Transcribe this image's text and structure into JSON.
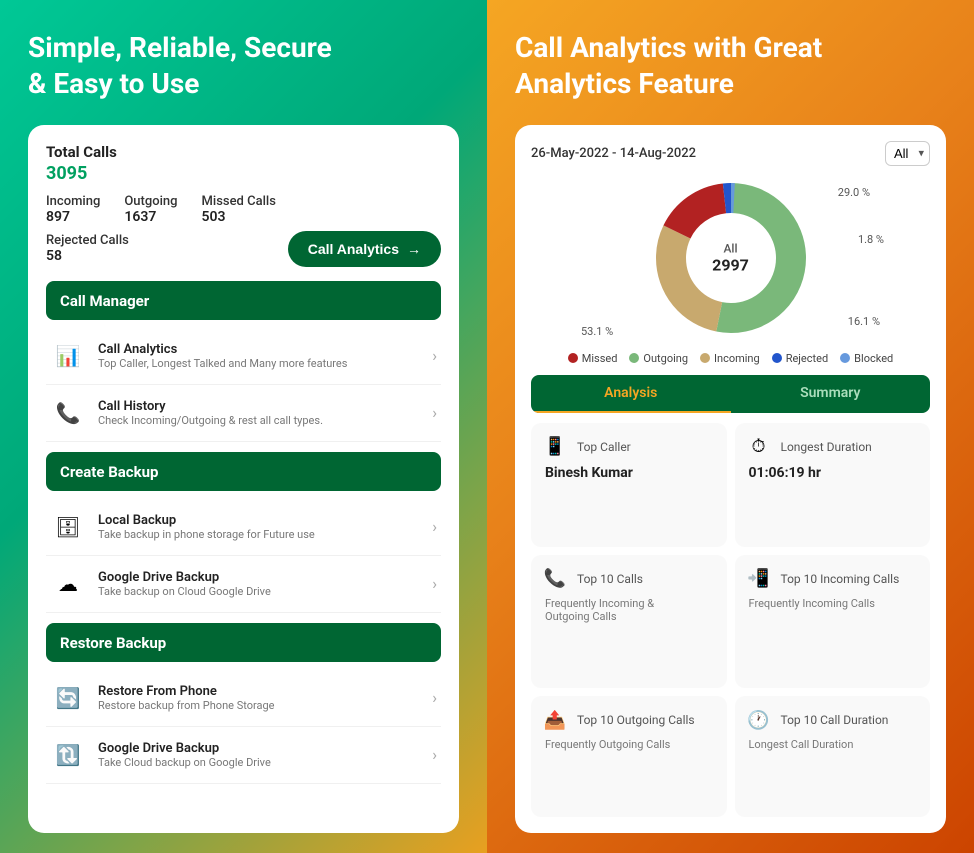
{
  "left": {
    "headline": "Simple, Reliable, Secure\n& Easy to Use",
    "card": {
      "total_calls_label": "Total Calls",
      "total_calls_value": "3095",
      "stats": [
        {
          "label": "Incoming",
          "value": "897"
        },
        {
          "label": "Outgoing",
          "value": "1637"
        },
        {
          "label": "Missed Calls",
          "value": "503"
        }
      ],
      "rejected_label": "Rejected Calls",
      "rejected_value": "58",
      "analytics_btn_label": "Call Analytics",
      "sections": [
        {
          "title": "Call Manager",
          "items": [
            {
              "icon": "📊",
              "title": "Call Analytics",
              "subtitle": "Top Caller, Longest Talked and Many more features"
            },
            {
              "icon": "📞",
              "title": "Call History",
              "subtitle": "Check Incoming/Outgoing & rest all call types."
            }
          ]
        },
        {
          "title": "Create Backup",
          "items": [
            {
              "icon": "🗄",
              "title": "Local Backup",
              "subtitle": "Take backup in phone storage for Future use"
            },
            {
              "icon": "☁",
              "title": "Google Drive Backup",
              "subtitle": "Take backup on Cloud Google Drive"
            }
          ]
        },
        {
          "title": "Restore Backup",
          "items": [
            {
              "icon": "🔄",
              "title": "Restore From Phone",
              "subtitle": "Restore backup from Phone Storage"
            },
            {
              "icon": "🔃",
              "title": "Google Drive Backup",
              "subtitle": "Take Cloud backup on Google Drive"
            }
          ]
        }
      ]
    }
  },
  "right": {
    "headline": "Call Analytics with Great\nAnalytics Feature",
    "card": {
      "date_range": "26-May-2022 - 14-Aug-2022",
      "filter_label": "All",
      "donut": {
        "center_label": "All",
        "center_value": "2997",
        "segments": [
          {
            "label": "Missed",
            "color": "#b22222",
            "percent": 16.1,
            "startAngle": 0
          },
          {
            "label": "Outgoing",
            "color": "#7ab87a",
            "percent": 53.1,
            "startAngle": 16.1
          },
          {
            "label": "Incoming",
            "color": "#c8a96e",
            "percent": 29.0,
            "startAngle": 69.2
          },
          {
            "label": "Rejected",
            "color": "#2255cc",
            "percent": 1.8,
            "startAngle": 98.2
          },
          {
            "label": "Blocked",
            "color": "#6699dd",
            "percent": 0.8,
            "startAngle": 100
          }
        ],
        "percentages": {
          "top_right": "29.0 %",
          "right_mid": "1.8 %",
          "bottom_right": "16.1 %",
          "bottom_left": "53.1 %"
        }
      },
      "legend": [
        {
          "label": "Missed",
          "color": "#b22222"
        },
        {
          "label": "Outgoing",
          "color": "#7ab87a"
        },
        {
          "label": "Incoming",
          "color": "#c8a96e"
        },
        {
          "label": "Rejected",
          "color": "#2255cc"
        },
        {
          "label": "Blocked",
          "color": "#6699dd"
        }
      ],
      "tabs": [
        {
          "label": "Analysis",
          "active": true
        },
        {
          "label": "Summary",
          "active": false
        }
      ],
      "analytics": [
        {
          "icon": "📱",
          "label": "Top Caller",
          "value": "Binesh Kumar",
          "sublabel": ""
        },
        {
          "icon": "⏱",
          "label": "Longest Duration",
          "value": "01:06:19 hr",
          "sublabel": ""
        },
        {
          "icon": "📞",
          "label": "Top 10 Calls",
          "value": "",
          "sublabel": "Frequently Incoming &\nOutgoing Calls"
        },
        {
          "icon": "📲",
          "label": "Top 10 Incoming Calls",
          "value": "",
          "sublabel": "Frequently Incoming Calls"
        },
        {
          "icon": "📤",
          "label": "Top 10 Outgoing Calls",
          "value": "",
          "sublabel": "Frequently Outgoing Calls"
        },
        {
          "icon": "🕐",
          "label": "Top 10 Call Duration",
          "value": "",
          "sublabel": "Longest Call Duration"
        }
      ]
    }
  },
  "colors": {
    "dark_green": "#006633",
    "accent_green": "#00a060",
    "missed": "#b22222",
    "outgoing": "#7ab87a",
    "incoming": "#c8a96e",
    "rejected": "#2255cc",
    "blocked": "#6699dd",
    "orange_accent": "#f5a623"
  }
}
